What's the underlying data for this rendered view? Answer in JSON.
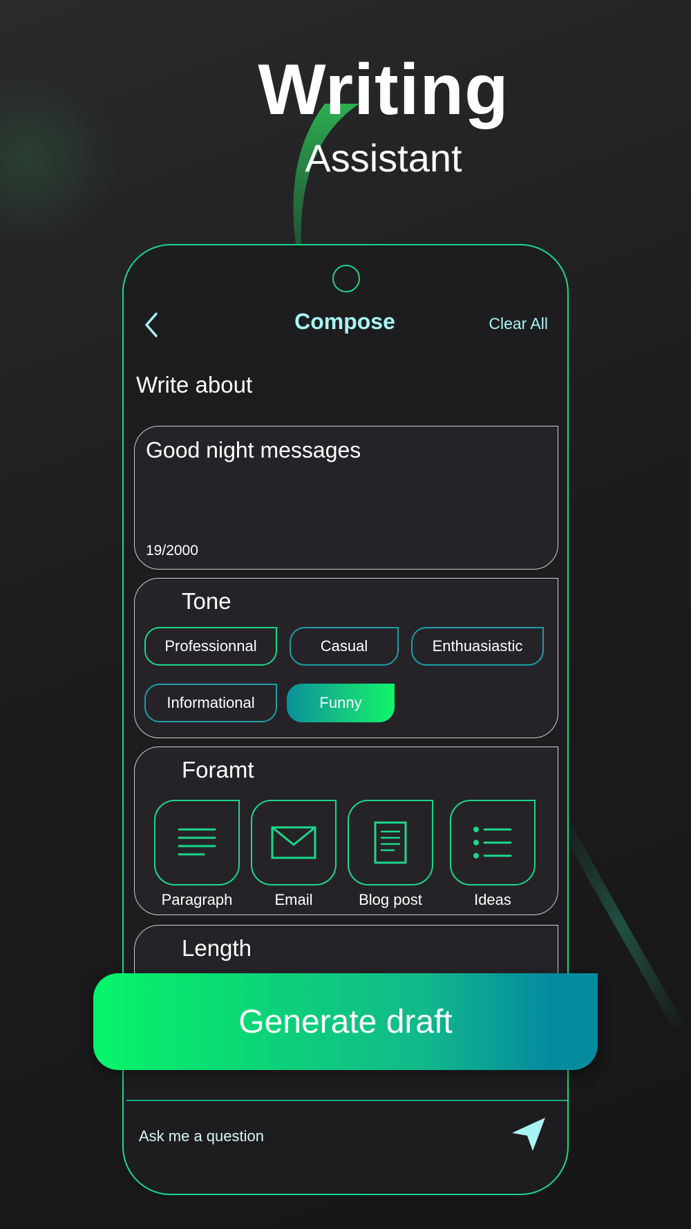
{
  "headline": {
    "title": "Writing",
    "subtitle": "Assistant"
  },
  "appbar": {
    "title": "Compose",
    "clear_all": "Clear All"
  },
  "compose": {
    "section_label": "Write about",
    "input_value": "Good night messages",
    "char_count": "19/2000"
  },
  "tone": {
    "title": "Tone",
    "options": [
      "Professionnal",
      "Casual",
      "Enthuasiastic",
      "Informational",
      "Funny"
    ],
    "selected": "Funny"
  },
  "format": {
    "title": "Foramt",
    "options": [
      "Paragraph",
      "Email",
      "Blog post",
      "Ideas"
    ]
  },
  "length": {
    "title": "Length"
  },
  "generate_label": "Generate draft",
  "ask": {
    "placeholder": "Ask me a question"
  },
  "colors": {
    "accent_green": "#1bd88a",
    "accent_teal": "#1ba0a5",
    "title_cyan": "#a9f3f5",
    "card_bg": "#252328",
    "background": "#1e1e20"
  },
  "icons": [
    "chevron-left-icon",
    "paragraph-icon",
    "email-icon",
    "blog-post-icon",
    "ideas-list-icon",
    "send-icon"
  ]
}
